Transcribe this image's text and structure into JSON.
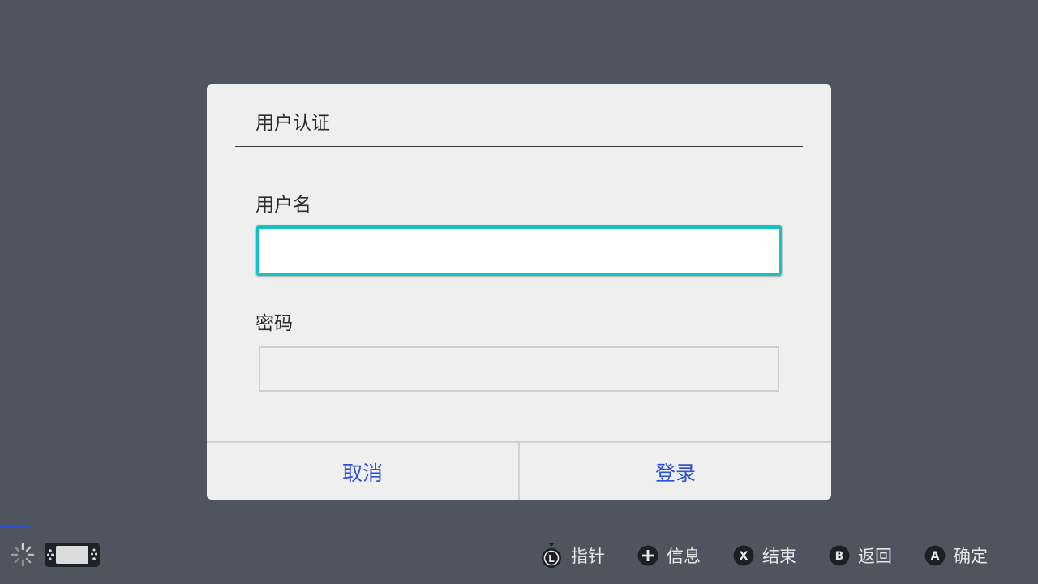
{
  "dialog": {
    "title": "用户认证",
    "username_label": "用户名",
    "username_value": "",
    "password_label": "密码",
    "password_value": "",
    "cancel_label": "取消",
    "login_label": "登录"
  },
  "footer": {
    "hints": [
      {
        "icon": "l-stick-icon",
        "label": "指针"
      },
      {
        "icon": "plus-button-icon",
        "label": "信息"
      },
      {
        "icon": "x-button-icon",
        "label": "结束"
      },
      {
        "icon": "b-button-icon",
        "label": "返回"
      },
      {
        "icon": "a-button-icon",
        "label": "确定"
      }
    ]
  },
  "colors": {
    "background": "#4f555e",
    "dialog": "#efefef",
    "focus_border": "#14c1c5",
    "button_text": "#2f4fd8"
  }
}
